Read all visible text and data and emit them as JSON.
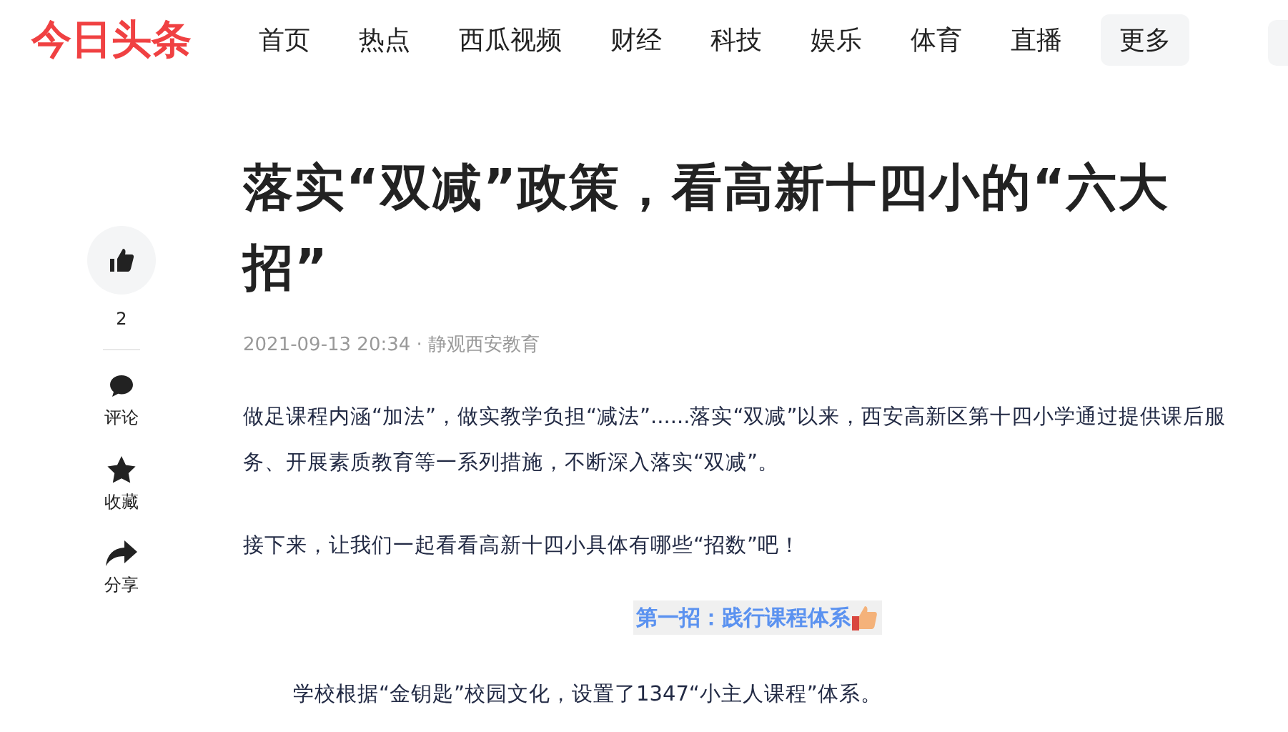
{
  "header": {
    "logo": "今日头条",
    "nav": [
      {
        "label": "首页",
        "kind": "link"
      },
      {
        "label": "热点",
        "kind": "link"
      },
      {
        "label": "西瓜视频",
        "kind": "link"
      },
      {
        "label": "财经",
        "kind": "link"
      },
      {
        "label": "科技",
        "kind": "link"
      },
      {
        "label": "娱乐",
        "kind": "link"
      },
      {
        "label": "体育",
        "kind": "link"
      },
      {
        "label": "直播",
        "kind": "link"
      },
      {
        "label": "更多",
        "kind": "more"
      }
    ]
  },
  "actions": [
    {
      "kind": "like",
      "label": "2"
    },
    {
      "kind": "comment",
      "label": "评论"
    },
    {
      "kind": "favorite",
      "label": "收藏"
    },
    {
      "kind": "share",
      "label": "分享"
    }
  ],
  "article": {
    "title": "落实“双减”政策，看高新十四小的“六大招”",
    "meta": "2021-09-13 20:34 · 静观西安教育",
    "blocks": [
      {
        "kind": "paragraph",
        "text": "做足课程内涵“加法”，做实教学负担“减法”......落实“双减”以来，西安高新区第十四小学通过提供课后服务、开展素质教育等一系列措施，不断深入落实“双减”。"
      },
      {
        "kind": "paragraph",
        "text": "接下来，让我们一起看看高新十四小具体有哪些“招数”吧！"
      },
      {
        "kind": "heading",
        "text": "第一招：践行课程体系"
      },
      {
        "kind": "indented",
        "text": "学校根据“金钥匙”校园文化，设置了1347“小主人课程”体系。"
      }
    ]
  }
}
